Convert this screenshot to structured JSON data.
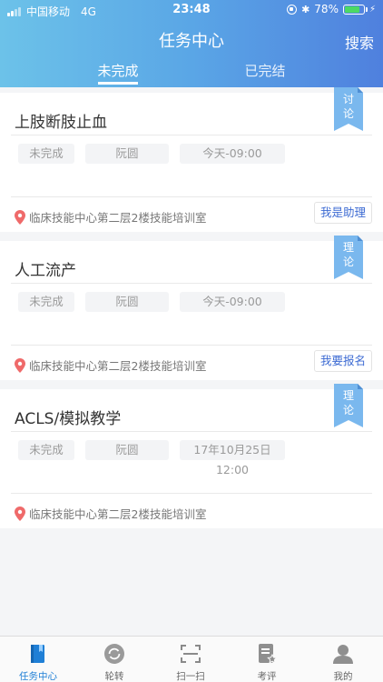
{
  "status_bar": {
    "carrier": "中国移动",
    "network": "4G",
    "time": "23:48",
    "battery": "78%",
    "battery_level": 0.78
  },
  "header": {
    "title": "任务中心",
    "search_label": "搜索",
    "tabs": [
      {
        "label": "未完成",
        "active": true
      },
      {
        "label": "已完结",
        "active": false
      }
    ]
  },
  "tasks": [
    {
      "title": "上肢断肢止血",
      "type_badge": "讨论",
      "status": "未完成",
      "person": "阮圆",
      "time": "今天-09:00",
      "location": "临床技能中心第二层2楼技能培训室",
      "action": "我是助理"
    },
    {
      "title": "人工流产",
      "type_badge": "理论",
      "status": "未完成",
      "person": "阮圆",
      "time": "今天-09:00",
      "location": "临床技能中心第二层2楼技能培训室",
      "action": "我要报名"
    },
    {
      "title": "ACLS/模拟教学",
      "type_badge": "理论",
      "status": "未完成",
      "person": "阮圆",
      "time": "17年10月25日 12:00",
      "location": "临床技能中心第二层2楼技能培训室",
      "action": ""
    }
  ],
  "tab_bar": [
    {
      "label": "任务中心",
      "icon": "book-icon",
      "active": true
    },
    {
      "label": "轮转",
      "icon": "rotate-icon",
      "active": false
    },
    {
      "label": "扫一扫",
      "icon": "scan-icon",
      "active": false
    },
    {
      "label": "考评",
      "icon": "evaluation-icon",
      "active": false
    },
    {
      "label": "我的",
      "icon": "profile-icon",
      "active": false
    }
  ],
  "colors": {
    "header_start": "#6cc2e9",
    "header_end": "#4f80de",
    "accent": "#1f7fd6",
    "badge": "#7ab8ee",
    "pin": "#ef6a6a"
  }
}
